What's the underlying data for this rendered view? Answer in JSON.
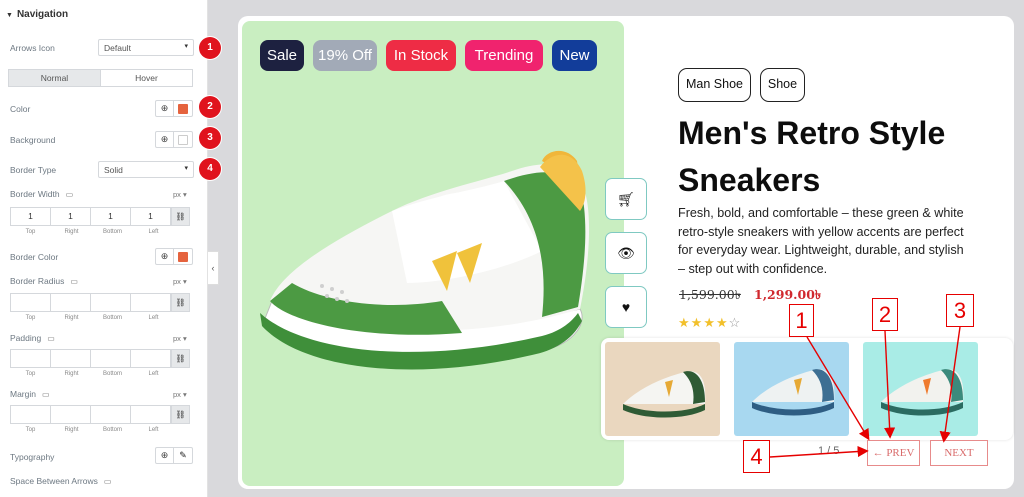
{
  "panel": {
    "section_title": "Navigation",
    "arrows_icon": {
      "label": "Arrows Icon",
      "value": "Default"
    },
    "tabs": [
      "Normal",
      "Hover"
    ],
    "color": {
      "label": "Color",
      "swatch": "#e5633e"
    },
    "background": {
      "label": "Background",
      "swatch": "#ffffff"
    },
    "border_type": {
      "label": "Border Type",
      "value": "Solid"
    },
    "border_width": {
      "label": "Border Width",
      "unit": "px",
      "values": [
        "1",
        "1",
        "1",
        "1"
      ]
    },
    "sides": [
      "Top",
      "Right",
      "Bottom",
      "Left"
    ],
    "border_color": {
      "label": "Border Color",
      "swatch": "#e5633e"
    },
    "border_radius": {
      "label": "Border Radius",
      "unit": "px"
    },
    "padding": {
      "label": "Padding",
      "unit": "px"
    },
    "margin": {
      "label": "Margin",
      "unit": "px"
    },
    "typography": {
      "label": "Typography"
    },
    "space_between": {
      "label": "Space Between Arrows"
    },
    "badges": [
      "1",
      "2",
      "3",
      "4"
    ]
  },
  "product": {
    "tags": [
      {
        "label": "Sale",
        "color": "#1d2140"
      },
      {
        "label": "19% Off",
        "color": "#a2aab7"
      },
      {
        "label": "In Stock",
        "color": "#ee2c45"
      },
      {
        "label": "Trending",
        "color": "#f0236e"
      },
      {
        "label": "New",
        "color": "#123d9a"
      }
    ],
    "categories": [
      "Man Shoe",
      "Shoe"
    ],
    "title": "Men's Retro Style Sneakers",
    "description": "Fresh, bold, and comfortable – these green & white retro-style sneakers with yellow accents are perfect for everyday wear. Lightweight, durable, and stylish – step out with confidence.",
    "price_old": "1,599.00৳",
    "price_new": "1,299.00৳",
    "rating": 4,
    "rating_max": 5,
    "pager": "1 / 5",
    "prev_label": "PREV",
    "next_label": "NEXT",
    "thumb_colors": [
      "#ead7bf",
      "#a8d8f0",
      "#a9ece6"
    ],
    "image_bg": "#c9eec1"
  },
  "annotations": [
    "1",
    "2",
    "3",
    "4"
  ]
}
